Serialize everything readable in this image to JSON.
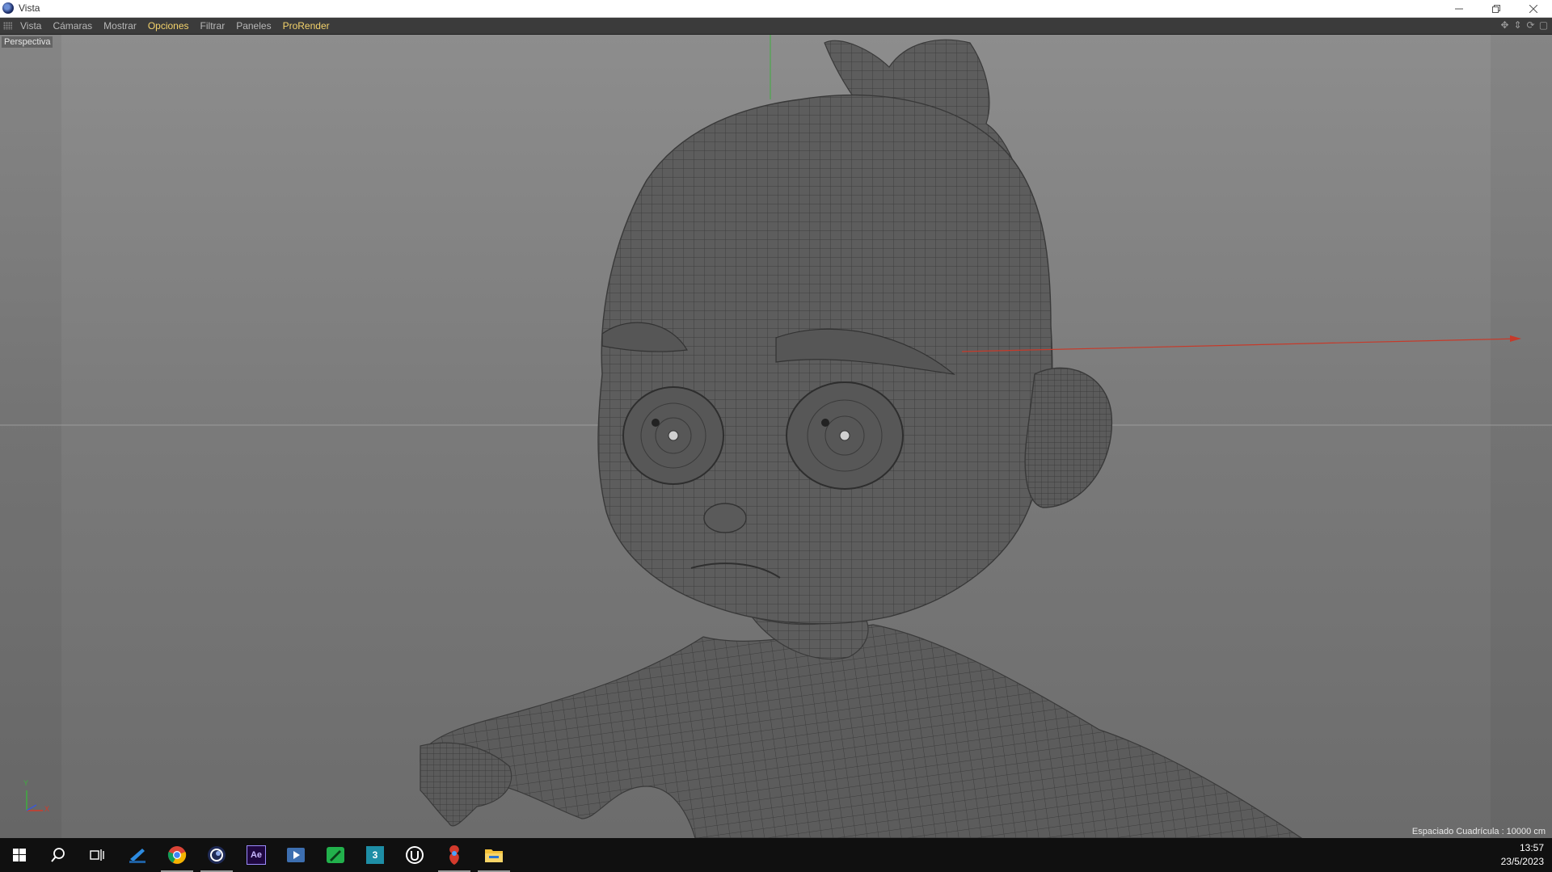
{
  "window": {
    "title": "Vista"
  },
  "menu": {
    "items": [
      {
        "label": "Vista",
        "highlight": false
      },
      {
        "label": "Cámaras",
        "highlight": false
      },
      {
        "label": "Mostrar",
        "highlight": false
      },
      {
        "label": "Opciones",
        "highlight": true
      },
      {
        "label": "Filtrar",
        "highlight": false
      },
      {
        "label": "Paneles",
        "highlight": false
      },
      {
        "label": "ProRender",
        "highlight": true
      }
    ],
    "highlight_color": "#f4d36b",
    "nav_icons": [
      "move-view-icon",
      "dolly-icon",
      "rotate-view-icon",
      "maximize-view-icon"
    ]
  },
  "viewport": {
    "camera_label": "Perspectiva",
    "grid_spacing": "Espaciado Cuadrícula : 10000 cm",
    "axis_labels": {
      "y": "Y",
      "x": "X",
      "z": "Z"
    },
    "axis_colors": {
      "x": "#d23a2a",
      "y": "#38b83a",
      "z": "#3a58d8"
    }
  },
  "taskbar": {
    "apps": [
      "windows-start-icon",
      "search-icon",
      "task-view-icon",
      "pen-app-icon",
      "chrome-icon",
      "cinema4d-icon",
      "after-effects-icon",
      "media-player-icon",
      "green-pen-app-icon",
      "3dsmax-icon",
      "unreal-engine-icon",
      "substance-app-icon",
      "file-explorer-icon"
    ],
    "ae_label": "Ae",
    "max_label": "3",
    "time": "13:57",
    "date": "23/5/2023"
  }
}
